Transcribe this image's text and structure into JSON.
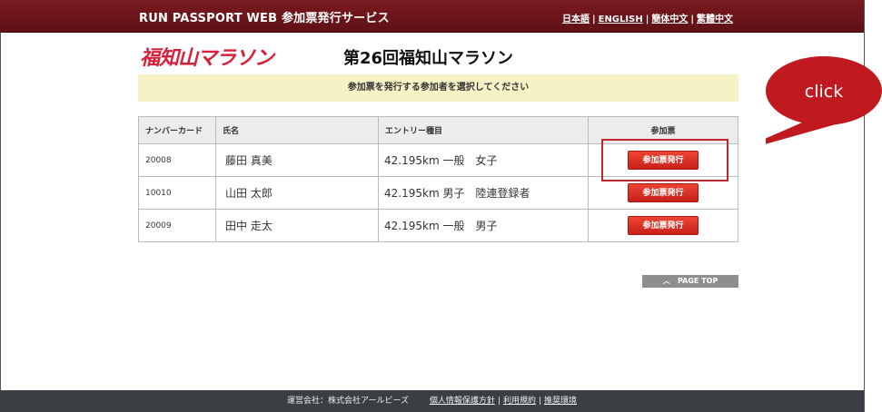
{
  "header": {
    "site_title": "RUN PASSPORT WEB  参加票発行サービス",
    "languages": [
      "日本語",
      "ENGLISH",
      "簡体中文",
      "繁體中文"
    ]
  },
  "event": {
    "logo_text": "福知山マラソン",
    "title": "第26回福知山マラソン"
  },
  "notice": "参加票を発行する参加者を選択してください",
  "table": {
    "headers": [
      "ナンバーカード",
      "氏名",
      "エントリー種目",
      "参加票"
    ],
    "rows": [
      {
        "number": "20008",
        "name": "藤田 真美",
        "entry": "42.195km 一般　女子",
        "action": "参加票発行"
      },
      {
        "number": "10010",
        "name": "山田 太郎",
        "entry": "42.195km 男子　陸連登録者",
        "action": "参加票発行"
      },
      {
        "number": "20009",
        "name": "田中 走太",
        "entry": "42.195km 一般　男子",
        "action": "参加票発行"
      }
    ]
  },
  "callout": {
    "text": "click",
    "color": "#c0191f"
  },
  "page_top": "PAGE TOP",
  "footer": {
    "company": "運営会社：株式会社アールビーズ",
    "links": [
      "個人情報保護方針",
      "利用規約",
      "推奨環境"
    ]
  },
  "colors": {
    "header_bg": "#6b141a",
    "button_red": "#d92c22",
    "notice_bg": "#f7f2c6",
    "footer_bg": "#3b3f44"
  }
}
